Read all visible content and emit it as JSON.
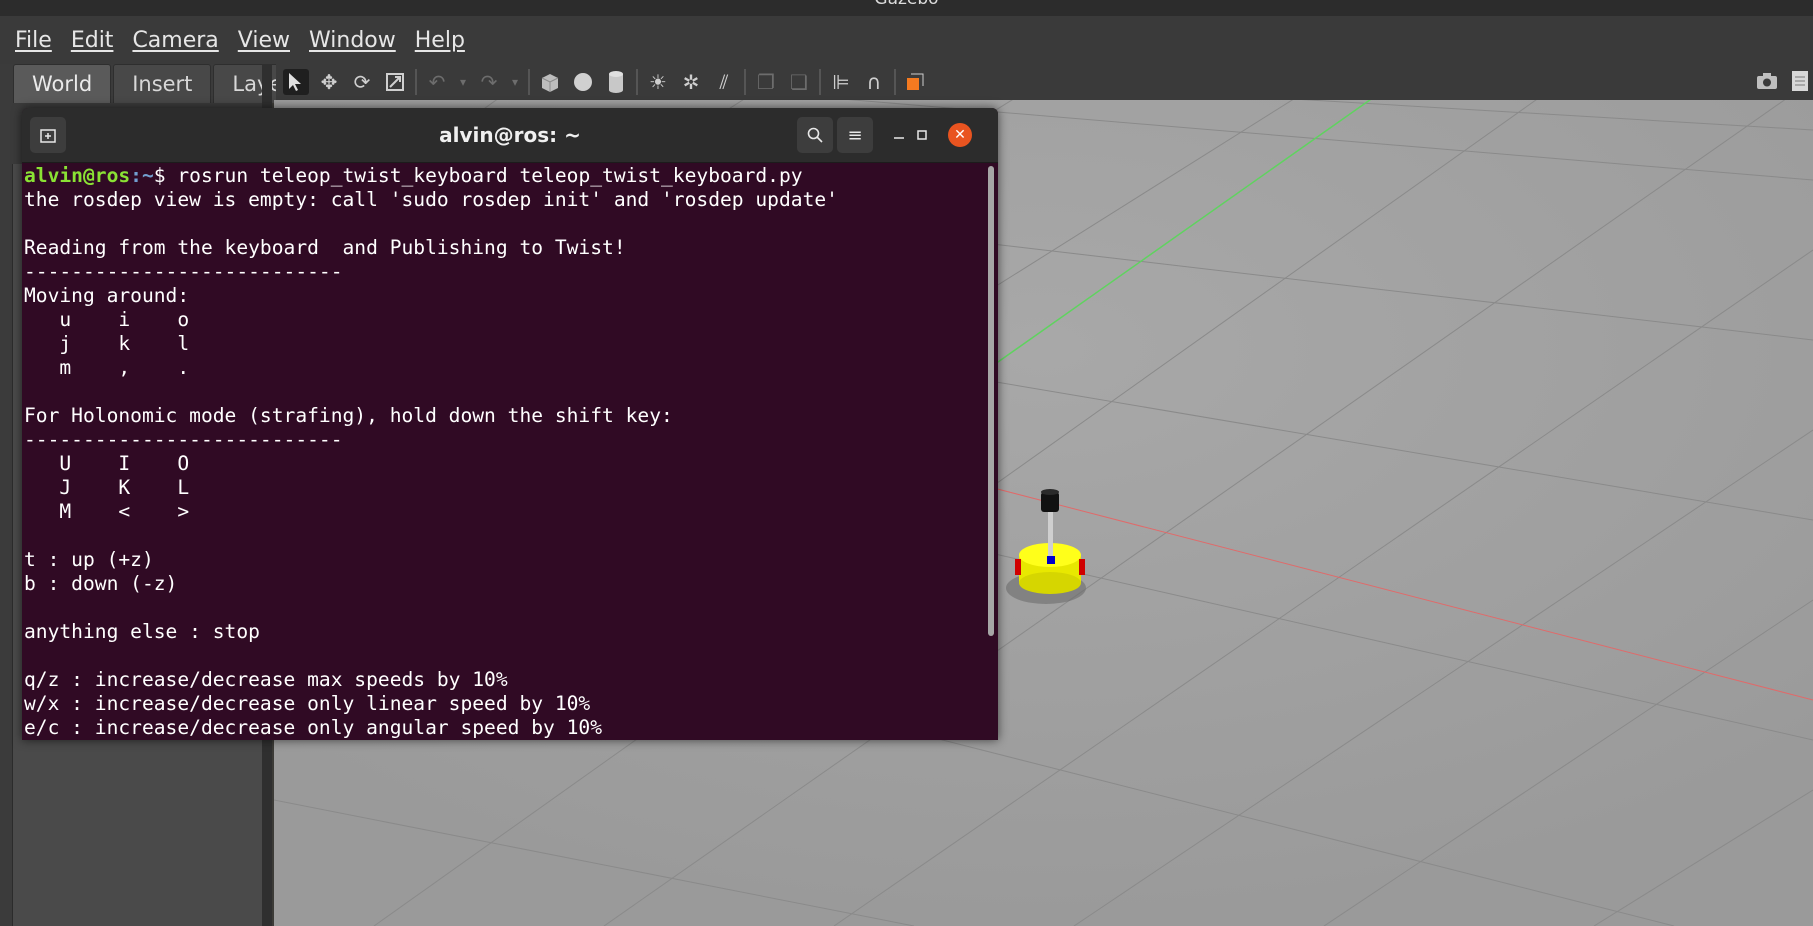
{
  "app": {
    "title": "Gazebo"
  },
  "menubar": {
    "items": [
      "File",
      "Edit",
      "Camera",
      "View",
      "Window",
      "Help"
    ]
  },
  "left_panel": {
    "tabs": [
      "World",
      "Insert",
      "Laye"
    ]
  },
  "toolbar": {
    "tools": [
      "select-icon",
      "translate-icon",
      "rotate-icon",
      "scale-icon",
      "undo-icon",
      "undo-menu-icon",
      "redo-icon",
      "redo-menu-icon",
      "box-icon",
      "sphere-icon",
      "cylinder-icon",
      "point-light-icon",
      "spot-light-icon",
      "directional-light-icon",
      "copy-icon",
      "paste-icon",
      "align-icon",
      "snap-icon",
      "view-angle-icon",
      "screenshot-icon",
      "log-icon"
    ]
  },
  "terminal": {
    "title": "alvin@ros: ~",
    "prompt_user": "alvin@ros",
    "prompt_path": ":~",
    "prompt_symbol": "$ ",
    "command": "rosrun teleop_twist_keyboard teleop_twist_keyboard.py",
    "output": [
      "the rosdep view is empty: call 'sudo rosdep init' and 'rosdep update'",
      "",
      "Reading from the keyboard  and Publishing to Twist!",
      "---------------------------",
      "Moving around:",
      "   u    i    o",
      "   j    k    l",
      "   m    ,    .",
      "",
      "For Holonomic mode (strafing), hold down the shift key:",
      "---------------------------",
      "   U    I    O",
      "   J    K    L",
      "   M    <    >",
      "",
      "t : up (+z)",
      "b : down (-z)",
      "",
      "anything else : stop",
      "",
      "q/z : increase/decrease max speeds by 10%",
      "w/x : increase/decrease only linear speed by 10%",
      "e/c : increase/decrease only angular speed by 10%"
    ]
  },
  "colors": {
    "terminal_bg": "#300a24",
    "prompt_user": "#8ae234",
    "prompt_path": "#729fcf",
    "close_button": "#e95420",
    "robot_body": "#ffff00"
  }
}
